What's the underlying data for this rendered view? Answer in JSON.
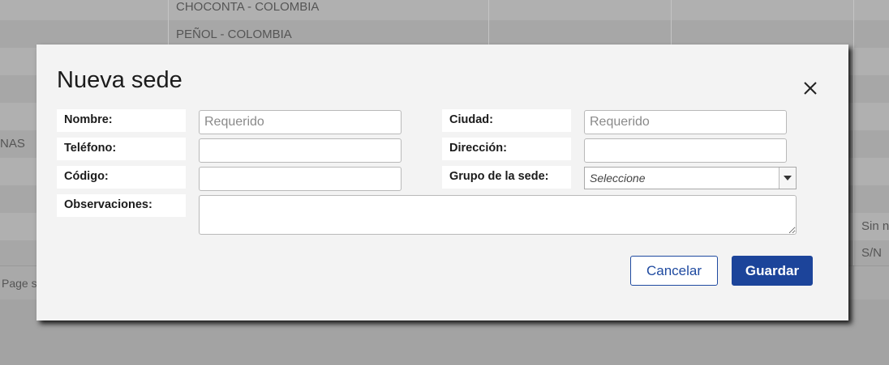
{
  "background": {
    "rows": [
      {
        "place": "CHOCONTA - COLOMBIA"
      },
      {
        "place": "PEÑOL - COLOMBIA"
      }
    ],
    "left_fragment": "NAS",
    "right_fragments": [
      "Sin n",
      "S/N"
    ],
    "footer_fragment": "Page s"
  },
  "modal": {
    "title": "Nueva sede",
    "fields": {
      "nombre": {
        "label": "Nombre:",
        "placeholder": "Requerido",
        "value": ""
      },
      "ciudad": {
        "label": "Ciudad:",
        "placeholder": "Requerido",
        "value": ""
      },
      "telefono": {
        "label": "Teléfono:",
        "placeholder": "",
        "value": ""
      },
      "direccion": {
        "label": "Dirección:",
        "placeholder": "",
        "value": ""
      },
      "codigo": {
        "label": "Código:",
        "placeholder": "",
        "value": ""
      },
      "grupo": {
        "label": "Grupo de la sede:",
        "selected": "Seleccione"
      },
      "observaciones": {
        "label": "Observaciones:",
        "value": ""
      }
    },
    "buttons": {
      "cancel": "Cancelar",
      "save": "Guardar"
    }
  },
  "colors": {
    "primary": "#1c449a",
    "modal_bg": "#f3f3f3",
    "overlay": "#9e9e9e"
  },
  "icons": {
    "close": "close-icon",
    "dropdown": "chevron-down-icon"
  }
}
